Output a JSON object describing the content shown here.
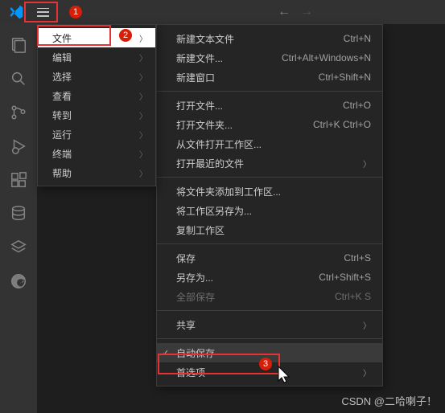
{
  "titlebar": {
    "nav_back": "←",
    "nav_fwd": "→"
  },
  "annotations": {
    "a1": "1",
    "a2": "2",
    "a3": "3"
  },
  "menu1": {
    "items": [
      {
        "label": "文件"
      },
      {
        "label": "编辑"
      },
      {
        "label": "选择"
      },
      {
        "label": "查看"
      },
      {
        "label": "转到"
      },
      {
        "label": "运行"
      },
      {
        "label": "终端"
      },
      {
        "label": "帮助"
      }
    ]
  },
  "menu2": {
    "groups": [
      [
        {
          "label": "新建文本文件",
          "shortcut": "Ctrl+N"
        },
        {
          "label": "新建文件...",
          "shortcut": "Ctrl+Alt+Windows+N"
        },
        {
          "label": "新建窗口",
          "shortcut": "Ctrl+Shift+N"
        }
      ],
      [
        {
          "label": "打开文件...",
          "shortcut": "Ctrl+O"
        },
        {
          "label": "打开文件夹...",
          "shortcut": "Ctrl+K Ctrl+O"
        },
        {
          "label": "从文件打开工作区...",
          "shortcut": ""
        },
        {
          "label": "打开最近的文件",
          "shortcut": "",
          "submenu": true
        }
      ],
      [
        {
          "label": "将文件夹添加到工作区...",
          "shortcut": ""
        },
        {
          "label": "将工作区另存为...",
          "shortcut": ""
        },
        {
          "label": "复制工作区",
          "shortcut": ""
        }
      ],
      [
        {
          "label": "保存",
          "shortcut": "Ctrl+S"
        },
        {
          "label": "另存为...",
          "shortcut": "Ctrl+Shift+S"
        },
        {
          "label": "全部保存",
          "shortcut": "Ctrl+K S",
          "disabled": true
        }
      ],
      [
        {
          "label": "共享",
          "shortcut": "",
          "submenu": true
        }
      ],
      [
        {
          "label": "自动保存",
          "shortcut": "",
          "checked": true,
          "selected": true
        },
        {
          "label": "首选项",
          "shortcut": "",
          "submenu": true
        }
      ]
    ]
  },
  "watermark": "CSDN @二哈喇子！"
}
